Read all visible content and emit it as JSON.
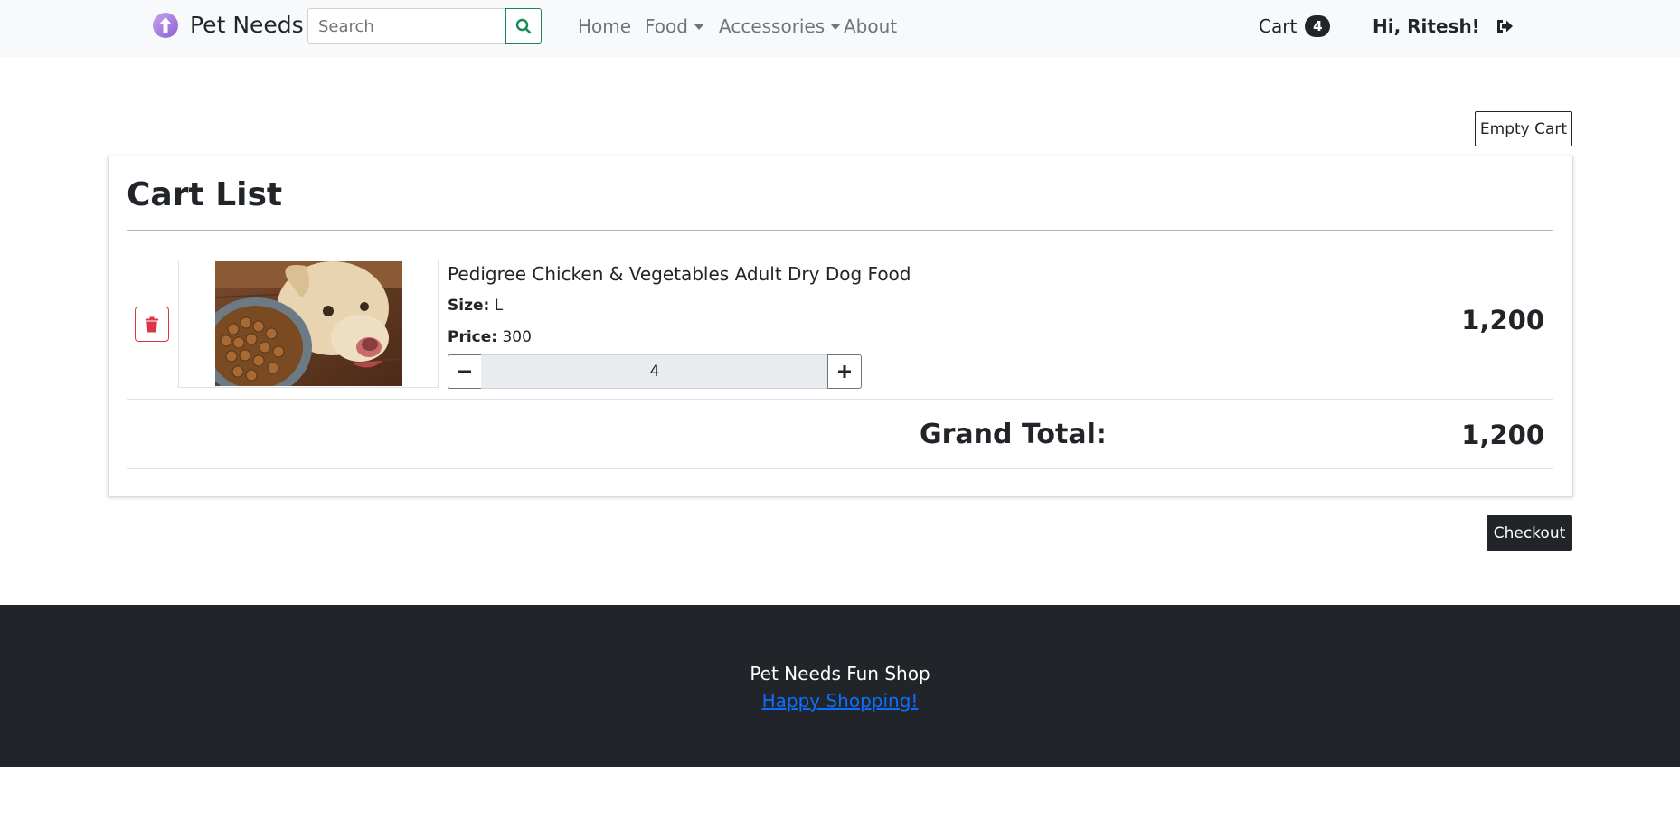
{
  "navbar": {
    "brand": "Pet Needs",
    "search_placeholder": "Search",
    "links": [
      {
        "label": "Home"
      },
      {
        "label": "Food"
      },
      {
        "label": "Accessories"
      },
      {
        "label": "About"
      }
    ],
    "cart_label": "Cart",
    "cart_count": "4",
    "greeting": "Hi, Ritesh!",
    "logout_icon": "sign-out-icon"
  },
  "cart": {
    "empty_cart_label": "Empty Cart",
    "title": "Cart List",
    "items": [
      {
        "name": "Pedigree Chicken & Vegetables Adult Dry Dog Food",
        "size_label": "Size:",
        "size": "L",
        "price_label": "Price:",
        "price": "300",
        "quantity": "4",
        "total": "1,200"
      }
    ],
    "grand_total_label": "Grand Total:",
    "grand_total": "1,200",
    "checkout_label": "Checkout"
  },
  "footer": {
    "title": "Pet Needs Fun Shop",
    "link": "Happy Shopping!"
  },
  "colors": {
    "navbar_bg": "#f8f9fa",
    "dark": "#212529",
    "danger": "#dc3545",
    "success": "#198754",
    "link": "#0d6efd"
  }
}
